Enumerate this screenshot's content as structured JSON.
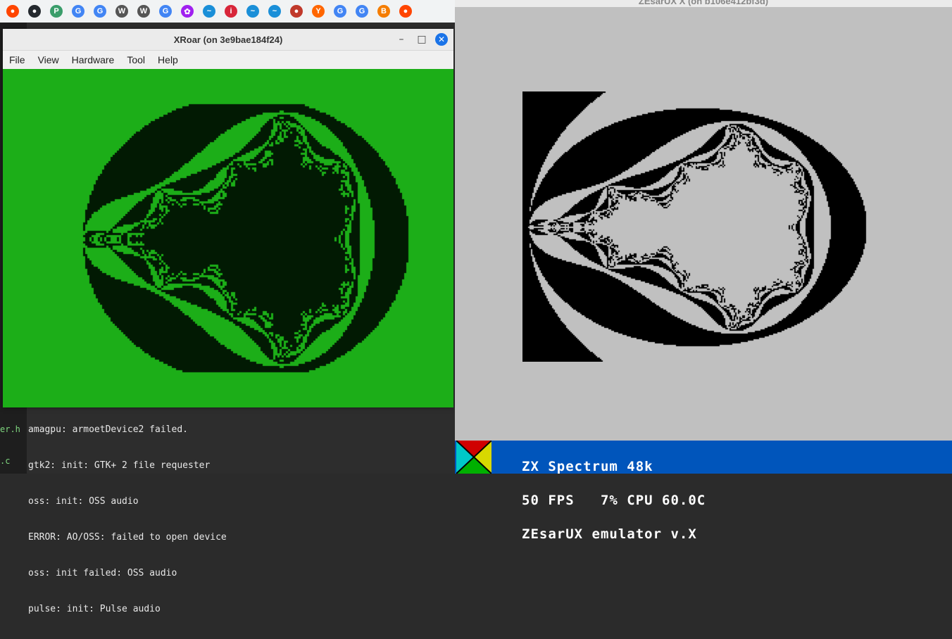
{
  "bookmarks": [
    {
      "icon": "reddit-icon",
      "glyph": "●",
      "color": "#ff4500"
    },
    {
      "icon": "github-icon",
      "glyph": "●",
      "color": "#24292e"
    },
    {
      "icon": "pypi-icon",
      "glyph": "P",
      "color": "#3a9d6a"
    },
    {
      "icon": "google-icon",
      "glyph": "G",
      "color": "#4285f4"
    },
    {
      "icon": "google-icon",
      "glyph": "G",
      "color": "#4285f4"
    },
    {
      "icon": "wikipedia-icon",
      "glyph": "W",
      "color": "#555555"
    },
    {
      "icon": "wikipedia-icon",
      "glyph": "W",
      "color": "#555555"
    },
    {
      "icon": "google-icon",
      "glyph": "G",
      "color": "#4285f4"
    },
    {
      "icon": "gear-icon",
      "glyph": "✿",
      "color": "#a020f0"
    },
    {
      "icon": "bluesky-icon",
      "glyph": "~",
      "color": "#1a8fd8"
    },
    {
      "icon": "info-icon",
      "glyph": "i",
      "color": "#d8263a"
    },
    {
      "icon": "bluesky-icon",
      "glyph": "~",
      "color": "#1a8fd8"
    },
    {
      "icon": "bluesky-icon",
      "glyph": "~",
      "color": "#1a8fd8"
    },
    {
      "icon": "record-icon",
      "glyph": "●",
      "color": "#c0392b"
    },
    {
      "icon": "ycombinator-icon",
      "glyph": "Y",
      "color": "#ff6600"
    },
    {
      "icon": "google-icon",
      "glyph": "G",
      "color": "#4285f4"
    },
    {
      "icon": "google-icon",
      "glyph": "G",
      "color": "#4285f4"
    },
    {
      "icon": "blogger-icon",
      "glyph": "B",
      "color": "#f57d00"
    },
    {
      "icon": "reddit-icon",
      "glyph": "●",
      "color": "#ff4500"
    }
  ],
  "xroar": {
    "title": "XRoar (on 3e9bae184f24)",
    "menu": [
      "File",
      "View",
      "Hardware",
      "Tool",
      "Help"
    ],
    "bg_color": "#1cae18",
    "fg_color": "#021a03"
  },
  "terminal": {
    "lines": [
      "amagpu: armoetDevice2 failed.",
      "gtk2: init: GTK+ 2 file requester",
      "oss: init: OSS audio",
      "ERROR: AO/OSS: failed to open device",
      "oss: init failed: OSS audio",
      "pulse: init: Pulse audio"
    ],
    "gutter": [
      "er.h",
      ".c"
    ]
  },
  "zesarux": {
    "title": "ZEsarUX X (on b106e412bf3d)",
    "status_lines": [
      "ZX Spectrum 48k",
      "50 FPS   7% CPU 60.0C",
      "ZEsarUX emulator v.X"
    ],
    "ink": "#000000",
    "paper": "#c0c0c0"
  }
}
